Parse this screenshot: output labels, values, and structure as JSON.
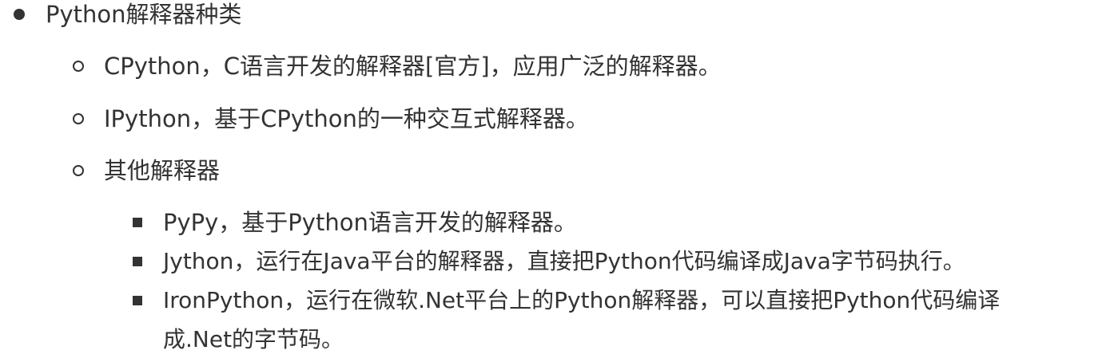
{
  "list": {
    "title": "Python解释器种类",
    "items": [
      {
        "text": "CPython，C语言开发的解释器[官方]，应用广泛的解释器。"
      },
      {
        "text": "IPython，基于CPython的一种交互式解释器。"
      },
      {
        "text": "其他解释器"
      }
    ],
    "sub_items": [
      {
        "text": "PyPy，基于Python语言开发的解释器。"
      },
      {
        "text": "Jython，运行在Java平台的解释器，直接把Python代码编译成Java字节码执行。"
      },
      {
        "text_line1": "IronPython，运行在微软.Net平台上的Python解释器，可以直接把Python代码编译",
        "text_line2": "成.Net的字节码。"
      }
    ]
  }
}
